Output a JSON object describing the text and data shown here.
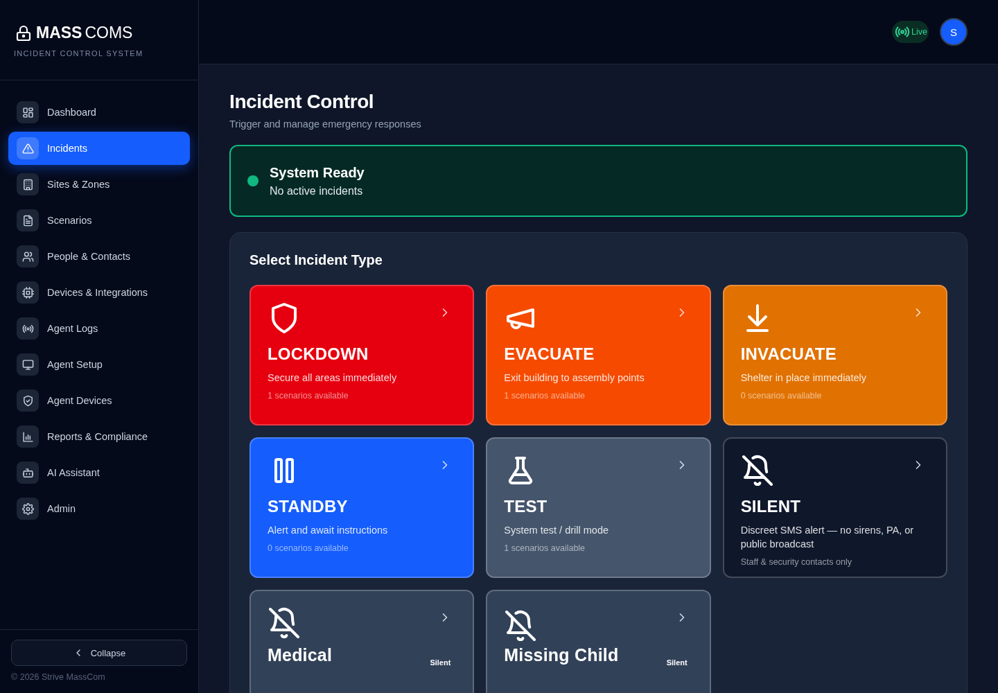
{
  "brand": {
    "name_bold": "MASS",
    "name_light": "COMS",
    "tagline": "INCIDENT CONTROL SYSTEM"
  },
  "nav": [
    {
      "label": "Dashboard",
      "selected": false
    },
    {
      "label": "Incidents",
      "selected": true
    },
    {
      "label": "Sites & Zones",
      "selected": false
    },
    {
      "label": "Scenarios",
      "selected": false
    },
    {
      "label": "People & Contacts",
      "selected": false
    },
    {
      "label": "Devices & Integrations",
      "selected": false
    },
    {
      "label": "Agent Logs",
      "selected": false
    },
    {
      "label": "Agent Setup",
      "selected": false
    },
    {
      "label": "Agent Devices",
      "selected": false
    },
    {
      "label": "Reports & Compliance",
      "selected": false
    },
    {
      "label": "AI Assistant",
      "selected": false
    },
    {
      "label": "Admin",
      "selected": false
    }
  ],
  "collapse_button": "Collapse",
  "copyright": "© 2026 Strive MassCom",
  "topbar": {
    "live_badge": "Live",
    "avatar": "S"
  },
  "page": {
    "title": "Incident Control",
    "subtitle": "Trigger and manage emergency responses"
  },
  "status": {
    "title": "System Ready",
    "message": "No active incidents"
  },
  "section_title": "Select Incident Type",
  "cards": [
    {
      "kind": "lockdown",
      "title": "LOCKDOWN",
      "description": "Secure all areas immediately",
      "note": "1 scenarios available",
      "color": "#e6000f"
    },
    {
      "kind": "evacuate",
      "title": "EVACUATE",
      "description": "Exit building to assembly points",
      "note": "1 scenarios available",
      "color": "#f54a00"
    },
    {
      "kind": "invacuate",
      "title": "INVACUATE",
      "description": "Shelter in place immediately",
      "note": "0 scenarios available",
      "color": "#e17100"
    },
    {
      "kind": "standby",
      "title": "STANDBY",
      "description": "Alert and await instructions",
      "note": "0 scenarios available",
      "color": "#155dfc"
    },
    {
      "kind": "test",
      "title": "TEST",
      "description": "System test / drill mode",
      "note": "1 scenarios available",
      "color": "#45556c"
    },
    {
      "kind": "silent",
      "title": "SILENT",
      "description": "Discreet SMS alert — no sirens, PA, or public broadcast",
      "note": "Staff & security contacts only",
      "color": "#0f172b"
    },
    {
      "kind": "custom",
      "title": "Medical",
      "badge": "Silent",
      "color": "#314158"
    },
    {
      "kind": "custom",
      "title": "Missing Child",
      "badge": "Silent",
      "color": "#314158"
    }
  ]
}
